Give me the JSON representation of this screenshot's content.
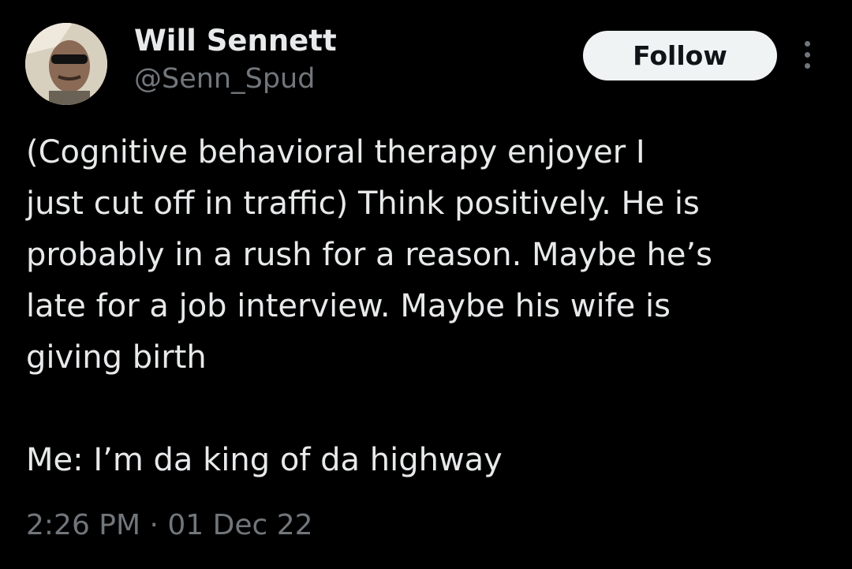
{
  "author": {
    "display_name": "Will Sennett",
    "handle": "@Senn_Spud"
  },
  "actions": {
    "follow_label": "Follow",
    "more_icon": "more-options-icon"
  },
  "tweet": {
    "line1": "(Cognitive behavioral therapy enjoyer I",
    "line2": "just cut off in traffic) Think positively. He is",
    "line3": "probably in a rush for a reason. Maybe he’s",
    "line4": "late for a job interview. Maybe his wife is",
    "line5": "giving birth",
    "line6": "Me: I’m da king of da highway",
    "timestamp": "2:26 PM · 01 Dec 22"
  },
  "colors": {
    "background": "#000000",
    "text_primary": "#e7e9ea",
    "text_secondary": "#71767b",
    "button_bg": "#eff3f4",
    "button_text": "#0f1419"
  }
}
